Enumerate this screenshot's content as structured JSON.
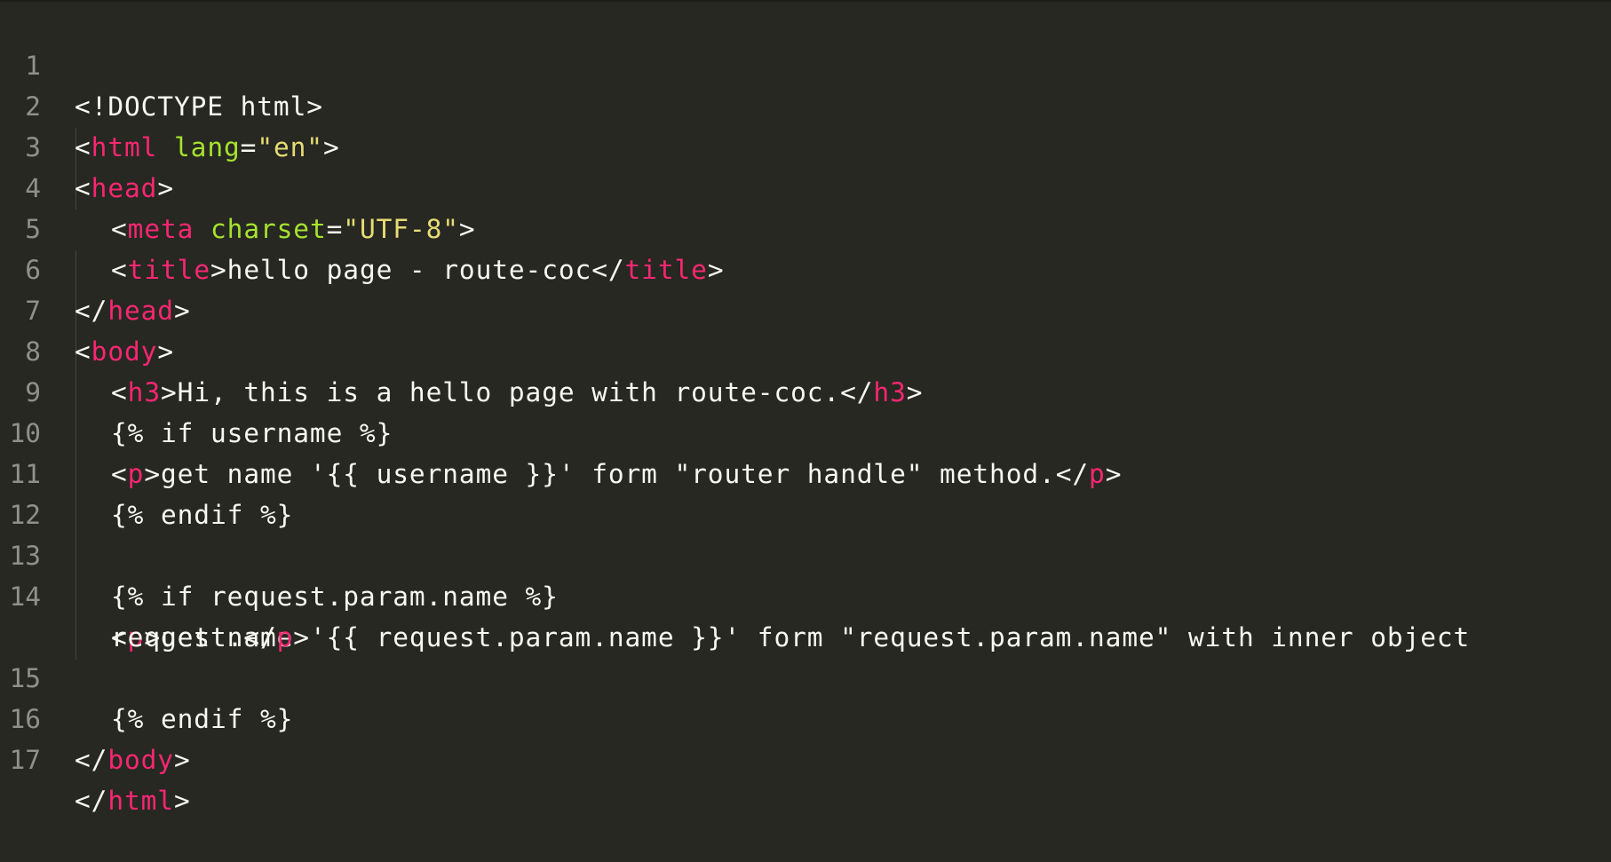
{
  "editor": {
    "lines": [
      {
        "num": "1"
      },
      {
        "num": "2"
      },
      {
        "num": "3"
      },
      {
        "num": "4"
      },
      {
        "num": "5"
      },
      {
        "num": "6"
      },
      {
        "num": "7"
      },
      {
        "num": "8"
      },
      {
        "num": "9"
      },
      {
        "num": "10"
      },
      {
        "num": "11"
      },
      {
        "num": "12"
      },
      {
        "num": "13"
      },
      {
        "num": "14"
      },
      {
        "num": "15"
      },
      {
        "num": "16"
      },
      {
        "num": "17"
      }
    ],
    "tokens": {
      "doctype": "<!DOCTYPE html>",
      "lt": "<",
      "gt": ">",
      "lt_slash": "</",
      "eq": "=",
      "html": "html",
      "lang": "lang",
      "lang_val": "\"en\"",
      "head": "head",
      "meta": "meta",
      "charset": "charset",
      "charset_val": "\"UTF-8\"",
      "title": "title",
      "title_text": "hello page - route-coc",
      "body": "body",
      "h3": "h3",
      "h3_text": "Hi, this is a hello page with route-coc.",
      "if_username": "{% if username %}",
      "p": "p",
      "p1_text": "get name '{{ username }}' form \"router handle\" method.",
      "endif": "{% endif %}",
      "if_request": "{% if request.param.name %}",
      "p2_text_a": "get name '{{ request.param.name }}' form \"request.param.name\" with inner object",
      "p2_text_b": "request."
    }
  }
}
